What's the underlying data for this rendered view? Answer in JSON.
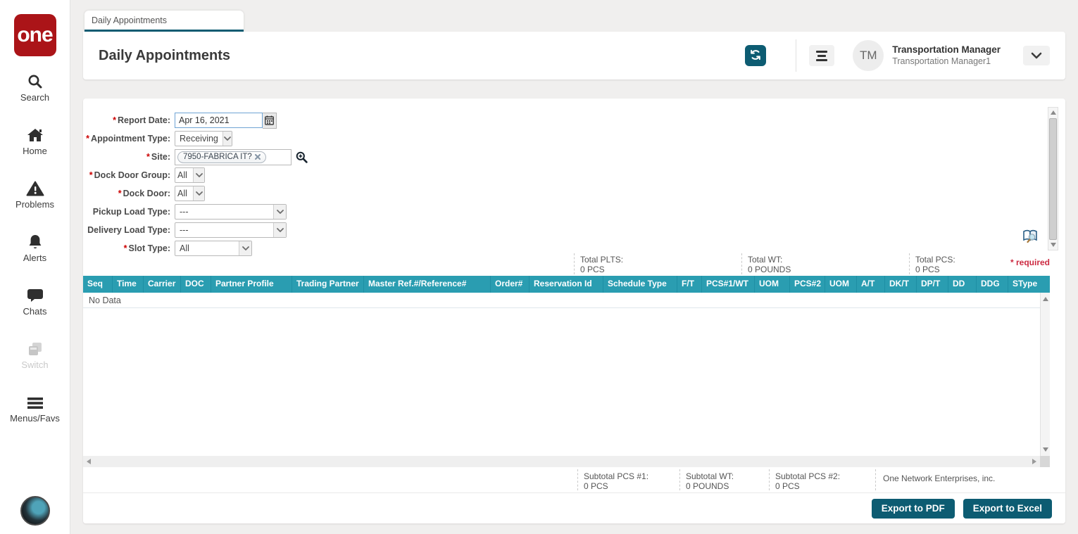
{
  "sidebar": {
    "logo_text": "one",
    "items": [
      {
        "label": "Search"
      },
      {
        "label": "Home"
      },
      {
        "label": "Problems"
      },
      {
        "label": "Alerts"
      },
      {
        "label": "Chats"
      },
      {
        "label": "Switch"
      },
      {
        "label": "Menus/Favs"
      }
    ]
  },
  "tab": {
    "label": "Daily Appointments"
  },
  "header": {
    "title": "Daily Appointments",
    "user": {
      "initials": "TM",
      "name": "Transportation Manager",
      "subtitle": "Transportation Manager1"
    }
  },
  "filters": {
    "required_marker": "*",
    "required_note": "* required",
    "report_date": {
      "label": "Report Date:",
      "value": "Apr 16, 2021"
    },
    "appointment_type": {
      "label": "Appointment Type:",
      "value": "Receiving"
    },
    "site": {
      "label": "Site:",
      "chip": "7950-FABRICA IT?"
    },
    "dock_door_group": {
      "label": "Dock Door Group:",
      "value": "All"
    },
    "dock_door": {
      "label": "Dock Door:",
      "value": "All"
    },
    "pickup_load_type": {
      "label": "Pickup Load Type:",
      "value": "---"
    },
    "delivery_load_type": {
      "label": "Delivery Load Type:",
      "value": "---"
    },
    "slot_type": {
      "label": "Slot Type:",
      "value": "All"
    }
  },
  "totals": [
    {
      "label": "Total PLTS:",
      "value": "0 PCS"
    },
    {
      "label": "Total WT:",
      "value": "0 POUNDS"
    },
    {
      "label": "Total PCS:",
      "value": "0 PCS"
    }
  ],
  "table": {
    "columns": [
      "Seq",
      "Time",
      "Carrier",
      "DOC",
      "Partner Profile",
      "Trading Partner",
      "Master Ref.#/Reference#",
      "Order#",
      "Reservation Id",
      "Schedule Type",
      "F/T",
      "PCS#1/WT",
      "UOM",
      "PCS#2",
      "UOM",
      "A/T",
      "DK/T",
      "DP/T",
      "DD",
      "DDG",
      "SType"
    ],
    "empty_text": "No Data"
  },
  "subtotals": [
    {
      "label": "Subtotal PCS #1:",
      "value": "0 PCS"
    },
    {
      "label": "Subtotal WT:",
      "value": "0 POUNDS"
    },
    {
      "label": "Subtotal PCS #2:",
      "value": "0 PCS"
    }
  ],
  "footer": {
    "company": "One Network Enterprises, inc.",
    "export_pdf_label": "Export to PDF",
    "export_excel_label": "Export to Excel"
  },
  "colors": {
    "brand_red": "#ab1418",
    "accent_teal_dark": "#0d5c72",
    "table_header_teal": "#2a9db1",
    "required_red": "#cc2a41"
  }
}
